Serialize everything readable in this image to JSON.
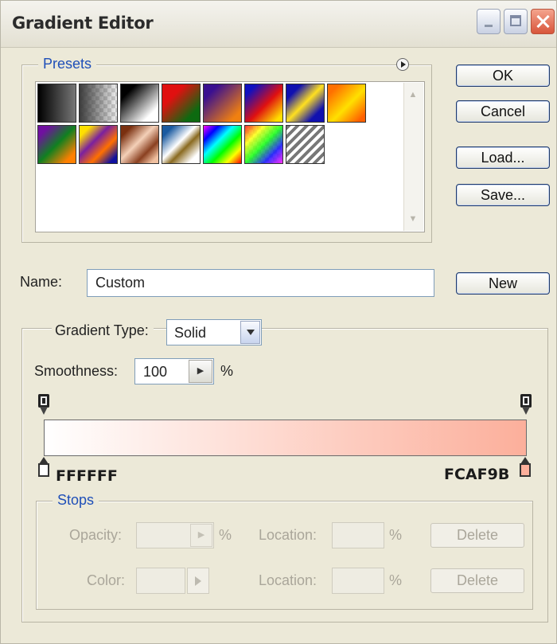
{
  "window": {
    "title": "Gradient Editor",
    "controls": [
      "minimize-icon",
      "maximize-icon",
      "close-icon"
    ]
  },
  "presets": {
    "label": "Presets",
    "menu_icon": "flyout-arrow-icon",
    "swatches": [
      {
        "name": "preset-foreground-to-background",
        "css": "linear-gradient(to right,#000,#777)"
      },
      {
        "name": "preset-foreground-to-transparent",
        "css": "linear-gradient(to right,rgba(60,60,60,1),rgba(200,200,200,.3)), repeating-conic-gradient(#ccc 0 25%, #fff 0 50%) 0 0/10px 10px"
      },
      {
        "name": "preset-black-white",
        "css": "linear-gradient(135deg,#000 20%,#fff 80%)"
      },
      {
        "name": "preset-red-green",
        "css": "linear-gradient(135deg,#e01010 30%,#0d6a10 80%)"
      },
      {
        "name": "preset-violet-orange",
        "css": "linear-gradient(135deg,#3a1090 20%,#f08010 85%)"
      },
      {
        "name": "preset-blue-red-yellow",
        "css": "linear-gradient(135deg,#1010c0 15%,#e01010 55%,#ffe000 90%)"
      },
      {
        "name": "preset-blue-yellow-blue",
        "css": "linear-gradient(135deg,#1010b0 20%,#ffe020 50%,#1010b0 80%)"
      },
      {
        "name": "preset-orange-yellow-orange",
        "css": "linear-gradient(135deg,#ff7000 15%,#ffe000 55%,#ff6000 90%)"
      },
      {
        "name": "preset-violet-green-orange",
        "css": "linear-gradient(135deg,#7010a0 15%,#108020 50%,#ff8000 85%)"
      },
      {
        "name": "preset-yellow-violet-orange-blue",
        "css": "linear-gradient(135deg,#ffe000 15%,#7a20a0 40%,#ff7000 65%,#1010a0 90%)"
      },
      {
        "name": "preset-copper",
        "css": "linear-gradient(135deg,#7a3010 15%,#f4d0b8 45%,#8a4020 70%,#f0c0a0 90%)"
      },
      {
        "name": "preset-chrome",
        "css": "linear-gradient(135deg,#1a5aa0 15%,#ffffff 45%,#8a6a20 60%,#ffffff 85%)"
      },
      {
        "name": "preset-spectrum",
        "css": "linear-gradient(135deg,#ff00ff,#0000ff,#00ffff,#00ff00,#ffff00,#ff0000)"
      },
      {
        "name": "preset-transparent-rainbow",
        "css": "linear-gradient(135deg,rgba(255,0,0,.8),rgba(255,255,0,.8),rgba(0,255,0,.8),rgba(0,0,255,.8),rgba(255,0,255,.8)), repeating-conic-gradient(#ddd 0 25%, #fff 0 50%) 0 0/10px 10px"
      },
      {
        "name": "preset-transparent-stripes",
        "css": "repeating-linear-gradient(135deg,#777 0 4px,#fff 4px 8px)"
      }
    ]
  },
  "buttons": {
    "ok": "OK",
    "cancel": "Cancel",
    "load": "Load...",
    "save": "Save...",
    "new": "New"
  },
  "name": {
    "label": "Name:",
    "value": "Custom"
  },
  "gradient": {
    "type_label": "Gradient Type:",
    "type_value": "Solid",
    "smoothness_label": "Smoothness:",
    "smoothness_value": "100",
    "smoothness_unit": "%",
    "left_color": "FFFFFF",
    "right_color": "FCAF9B",
    "left_color_hex": "#ffffff",
    "right_color_hex": "#fcaf9b"
  },
  "stops": {
    "label": "Stops",
    "opacity_label": "Opacity:",
    "opacity_unit": "%",
    "opacity_location_label": "Location:",
    "opacity_location_unit": "%",
    "opacity_delete": "Delete",
    "color_label": "Color:",
    "color_location_label": "Location:",
    "color_location_unit": "%",
    "color_delete": "Delete"
  }
}
